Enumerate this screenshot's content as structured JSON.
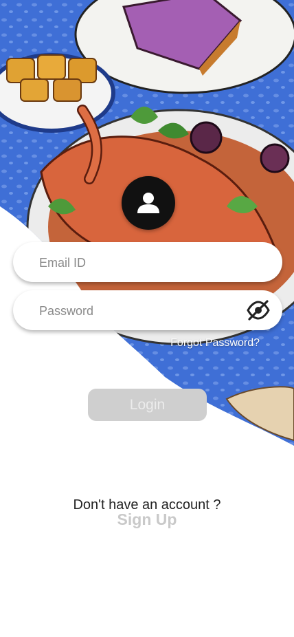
{
  "login": {
    "email_placeholder": "Email ID",
    "password_placeholder": "Password",
    "forgot_password": "Forgot Password?",
    "login_button": "Login",
    "no_account_text": "Don't have an account ?",
    "sign_up": "Sign Up"
  },
  "colors": {
    "background": "#ffffff",
    "table_blue": "#3f6fd6",
    "lobster": "#d8653d",
    "button_disabled": "#cfcfcf",
    "sign_up_text": "#c9c9c9"
  },
  "icons": {
    "avatar": "user-icon",
    "password_visibility": "eye-off-icon"
  }
}
